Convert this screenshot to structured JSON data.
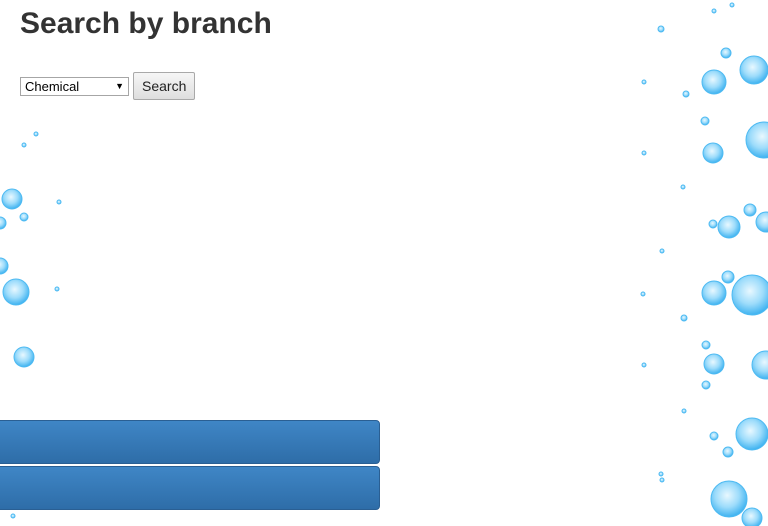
{
  "page": {
    "title": "Search by branch"
  },
  "search": {
    "branch_selected": "Chemical",
    "button_label": "Search"
  },
  "colors": {
    "bar": "#3479b8",
    "bubble": "#5bc0f5",
    "title": "#333333"
  }
}
